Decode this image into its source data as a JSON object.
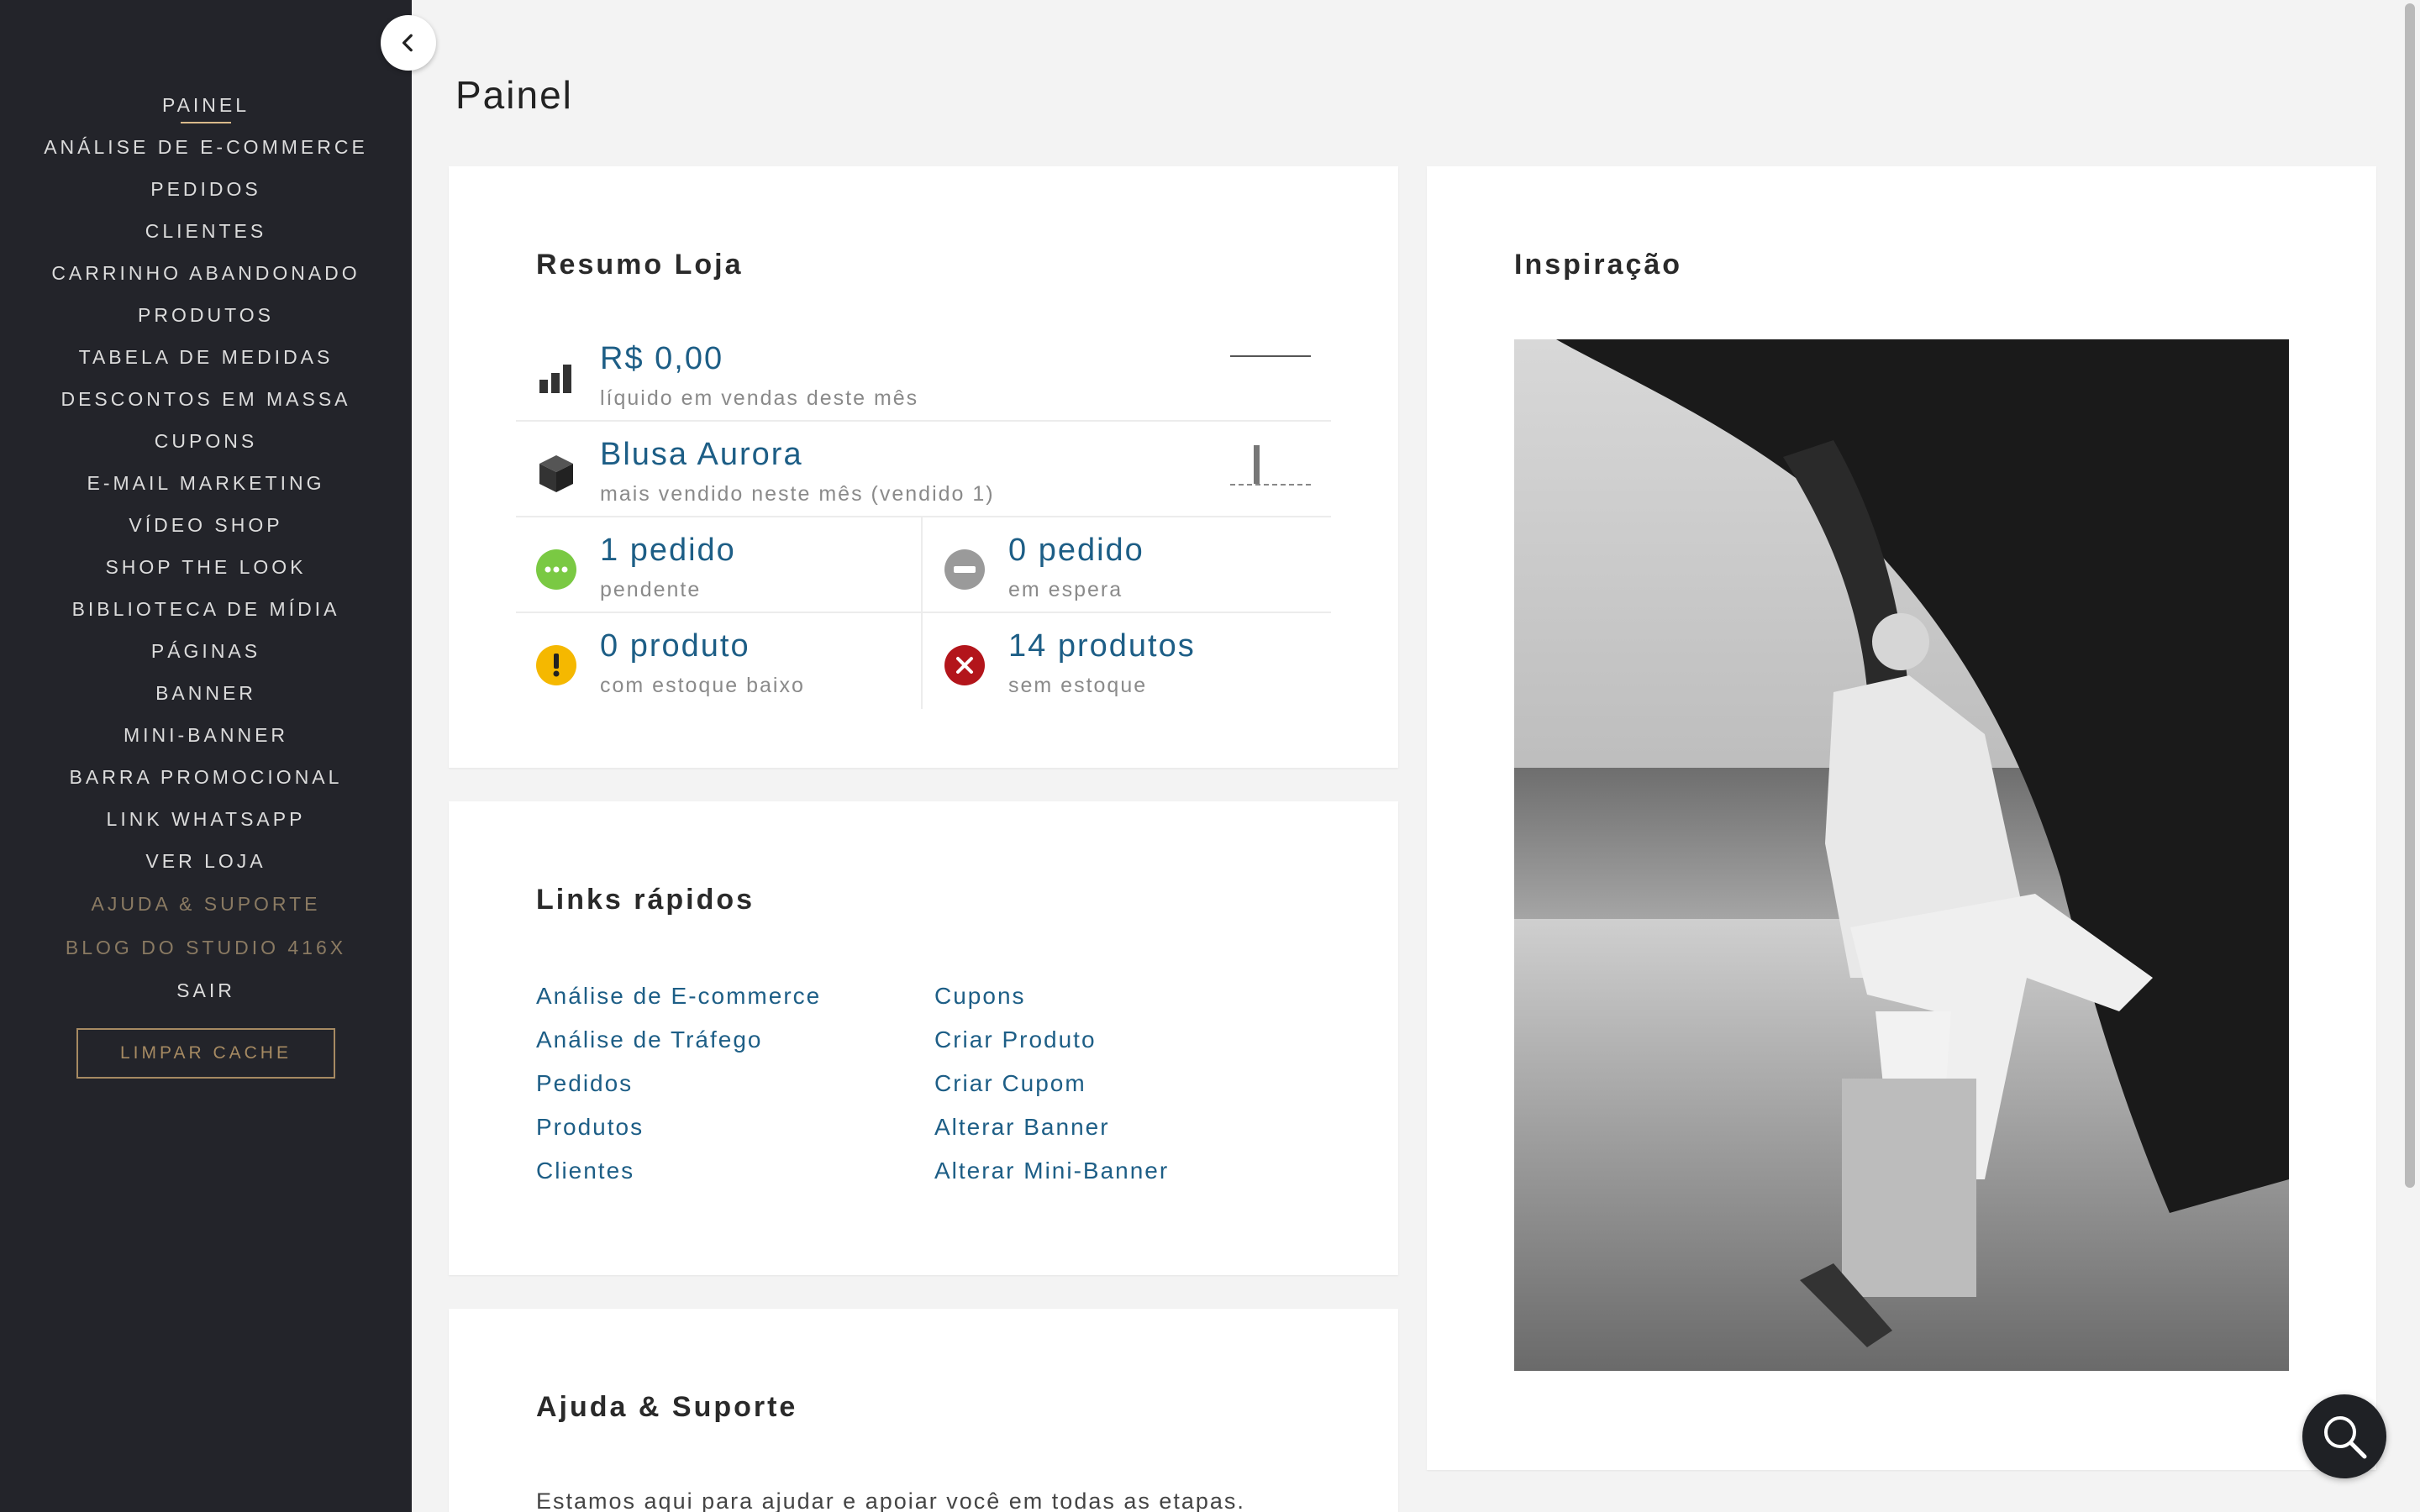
{
  "sidebar": {
    "items": [
      {
        "label": "PAINEL"
      },
      {
        "label": "ANÁLISE DE E-COMMERCE"
      },
      {
        "label": "PEDIDOS"
      },
      {
        "label": "CLIENTES"
      },
      {
        "label": "CARRINHO ABANDONADO"
      },
      {
        "label": "PRODUTOS"
      },
      {
        "label": "TABELA DE MEDIDAS"
      },
      {
        "label": "DESCONTOS EM MASSA"
      },
      {
        "label": "CUPONS"
      },
      {
        "label": "E-MAIL MARKETING"
      },
      {
        "label": "VÍDEO SHOP"
      },
      {
        "label": "SHOP THE LOOK"
      },
      {
        "label": "BIBLIOTECA DE MÍDIA"
      },
      {
        "label": "PÁGINAS"
      },
      {
        "label": "BANNER"
      },
      {
        "label": "MINI-BANNER"
      },
      {
        "label": "BARRA PROMOCIONAL"
      },
      {
        "label": "LINK WHATSAPP"
      },
      {
        "label": "VER LOJA"
      },
      {
        "label": "AJUDA & SUPORTE"
      },
      {
        "label": "BLOG DO STUDIO 416X"
      },
      {
        "label": "SAIR"
      }
    ],
    "clear_cache_label": "LIMPAR CACHE"
  },
  "header": {
    "title": "Painel"
  },
  "resumo": {
    "title": "Resumo Loja",
    "sales": {
      "value": "R$ 0,00",
      "label": "líquido em vendas deste mês",
      "icon": "bar-chart-icon"
    },
    "top_product": {
      "value": "Blusa Aurora",
      "label": "mais vendido neste mês (vendido 1)",
      "icon": "box-icon"
    },
    "pending": {
      "value": "1 pedido",
      "label": "pendente",
      "icon": "pending-icon",
      "color": "#7ac943"
    },
    "on_hold": {
      "value": "0 pedido",
      "label": "em espera",
      "icon": "on-hold-icon",
      "color": "#9a9a9a"
    },
    "low_stock": {
      "value": "0 produto",
      "label": "com estoque baixo",
      "icon": "warning-icon",
      "color": "#f5b800"
    },
    "out_of_stock": {
      "value": "14 produtos",
      "label": "sem estoque",
      "icon": "error-icon",
      "color": "#b3151b"
    }
  },
  "links": {
    "title": "Links rápidos",
    "left": [
      {
        "label": "Análise de E-commerce"
      },
      {
        "label": "Análise de Tráfego"
      },
      {
        "label": "Pedidos"
      },
      {
        "label": "Produtos"
      },
      {
        "label": "Clientes"
      }
    ],
    "right": [
      {
        "label": "Cupons"
      },
      {
        "label": "Criar Produto"
      },
      {
        "label": "Criar Cupom"
      },
      {
        "label": "Alterar Banner"
      },
      {
        "label": "Alterar Mini-Banner"
      }
    ]
  },
  "ajuda": {
    "title": "Ajuda & Suporte",
    "text": "Estamos aqui para ajudar e apoiar você em todas as etapas."
  },
  "inspiracao": {
    "title": "Inspiração"
  },
  "colors": {
    "accent": "#1d5e86",
    "sidebar_bg": "#23242a",
    "gold": "#a68a62"
  }
}
